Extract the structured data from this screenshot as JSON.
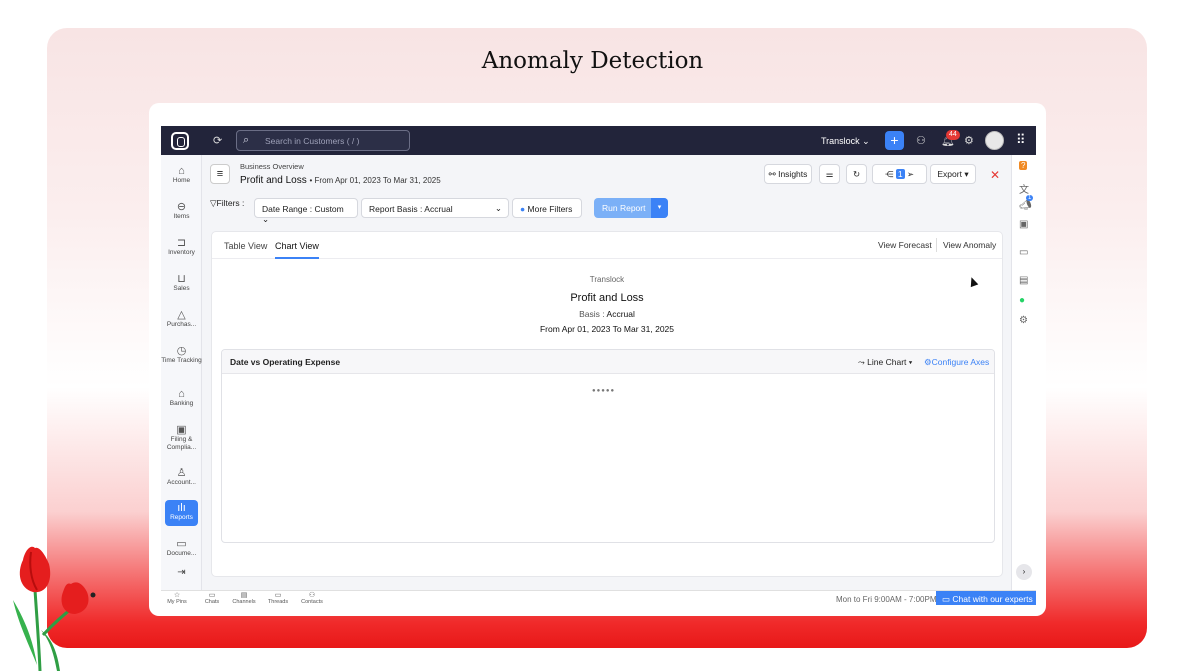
{
  "slide": {
    "title": "Anomaly Detection"
  },
  "colors": {
    "accent": "#3b82f6",
    "topbar": "#22243a",
    "danger": "#e53935"
  },
  "topbar": {
    "search_placeholder": "Search in Customers ( / )",
    "org": "Translock ⌄",
    "notification_count": "44",
    "icons": [
      "logo-icon",
      "refresh-icon",
      "search-icon",
      "plus-icon",
      "users-icon",
      "bell-icon",
      "gear-icon",
      "avatar",
      "apps-grid-icon"
    ]
  },
  "sidebar": {
    "items": [
      {
        "label": "Home",
        "icon": "⌂"
      },
      {
        "label": "Items",
        "icon": "⊖"
      },
      {
        "label": "Inventory",
        "icon": "⊐"
      },
      {
        "label": "Sales",
        "icon": "⊔"
      },
      {
        "label": "Purchas...",
        "icon": "△"
      },
      {
        "label": "Time Tracking",
        "icon": "◷"
      },
      {
        "label": "Banking",
        "icon": "⌂"
      },
      {
        "label": "Filing & Complia...",
        "icon": "▣"
      },
      {
        "label": "Account...",
        "icon": "♙"
      },
      {
        "label": "Reports",
        "icon": "ılı"
      },
      {
        "label": "Docume...",
        "icon": "▭"
      }
    ],
    "collapse_icon": "⇥"
  },
  "header": {
    "breadcrumb": "Business Overview",
    "title": "Profit and Loss",
    "range": "• From Apr 01, 2023 To Mar 31, 2025",
    "insights_label": "Insights",
    "schedule_count": "1",
    "export_label": "Export ▾"
  },
  "filters": {
    "label": "Filters :",
    "date_range": "Date Range :  Custom  ⌄",
    "report_basis": "Report Basis :  Accrual",
    "more_filters": "More Filters",
    "run_report": "Run Report"
  },
  "tabs": {
    "table_view": "Table View",
    "chart_view": "Chart View"
  },
  "links": {
    "view_forecast": "View Forecast",
    "view_anomaly": "View Anomaly"
  },
  "report": {
    "org": "Translock",
    "title": "Profit and Loss",
    "basis_label": "Basis : ",
    "basis_value": "Accrual",
    "range": "From Apr 01, 2023 To Mar 31, 2025"
  },
  "chart_panel": {
    "title": "Date vs Operating Expense",
    "type_label": "Line Chart ▾",
    "configure_label": "Configure Axes",
    "loading": "●●●●●"
  },
  "bottom_bar": {
    "items": [
      "My Pins",
      "Chats",
      "Channels",
      "Threads",
      "Contacts"
    ],
    "hours": "Mon to Fri 9:00AM - 7:00PM",
    "chat_label": "Chat with our experts"
  },
  "right_sidebar": {
    "badge": "1"
  }
}
